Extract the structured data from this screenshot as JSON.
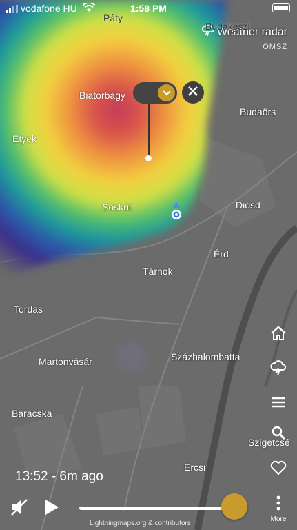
{
  "status_bar": {
    "carrier": "vodafone HU",
    "time": "1:58 PM"
  },
  "radar": {
    "title": "Weather radar",
    "source": "OMSZ"
  },
  "places": [
    {
      "name": "Páty",
      "style": "dark"
    },
    {
      "name": "Budakeszi",
      "style": "dark"
    },
    {
      "name": "Biatorbágy",
      "style": "light"
    },
    {
      "name": "Budaörs",
      "style": "light"
    },
    {
      "name": "Etyek",
      "style": "light"
    },
    {
      "name": "Sóskút",
      "style": "light"
    },
    {
      "name": "Diósd",
      "style": "light"
    },
    {
      "name": "Érd",
      "style": "light"
    },
    {
      "name": "Tárnok",
      "style": "light"
    },
    {
      "name": "Tordas",
      "style": "light"
    },
    {
      "name": "Martonvásár",
      "style": "light"
    },
    {
      "name": "Százhalombatta",
      "style": "light"
    },
    {
      "name": "Baracska",
      "style": "light"
    },
    {
      "name": "Szigetcsé",
      "style": "light"
    },
    {
      "name": "Ercsi",
      "style": "light"
    }
  ],
  "side_buttons": [
    {
      "name": "home-icon"
    },
    {
      "name": "storm-icon"
    },
    {
      "name": "menu-icon"
    },
    {
      "name": "search-icon"
    },
    {
      "name": "heart-icon"
    }
  ],
  "more_label": "More",
  "playback": {
    "timestamp": "13:52 - 6m ago",
    "progress": 0.98,
    "credit": "Lightningmaps.org & contributors"
  },
  "colors": {
    "accent": "#c99a2e",
    "map_base": "#6e6e6e"
  }
}
